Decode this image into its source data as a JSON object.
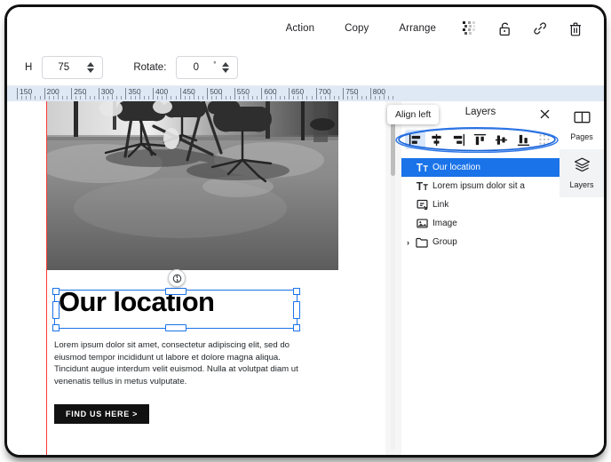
{
  "toolbar": {
    "actions": [
      {
        "label": "Action",
        "name": "action-button"
      },
      {
        "label": "Copy",
        "name": "copy-button"
      },
      {
        "label": "Arrange",
        "name": "arrange-button"
      }
    ],
    "icons": [
      {
        "name": "transparency-icon"
      },
      {
        "name": "unlock-icon"
      },
      {
        "name": "link-icon"
      },
      {
        "name": "trash-icon"
      }
    ]
  },
  "properties": {
    "height_label": "H",
    "height_value": "75",
    "rotate_label": "Rotate:",
    "rotate_value": "0",
    "degree_symbol": "°"
  },
  "ruler": {
    "ticks": [
      "150",
      "200",
      "250",
      "300",
      "350",
      "400",
      "450",
      "500",
      "550",
      "600",
      "650",
      "700",
      "750",
      "800"
    ]
  },
  "canvas": {
    "heading": "Our location",
    "paragraph": "Lorem ipsum dolor sit amet, consectetur adipiscing elit, sed do eiusmod tempor incididunt ut labore et dolore magna aliqua. Tincidunt augue interdum velit euismod. Nulla at volutpat diam ut venenatis tellus in metus vulputate.",
    "cta_label": "FIND US HERE >",
    "rotate_handle_name": "rotate-handle",
    "selection_color": "#1a73e8",
    "guide_color": "#ff3b30"
  },
  "panel": {
    "title": "Layers",
    "close_label": "✕",
    "tooltip": "Align left",
    "align_buttons": [
      {
        "name": "align-left-icon",
        "active": true
      },
      {
        "name": "align-center-horizontal-icon",
        "active": false
      },
      {
        "name": "align-right-icon",
        "active": false
      },
      {
        "name": "align-top-icon",
        "active": false
      },
      {
        "name": "align-middle-vertical-icon",
        "active": false
      },
      {
        "name": "align-bottom-icon",
        "active": false
      },
      {
        "name": "distribute-grid-icon",
        "active": false
      }
    ],
    "layers": [
      {
        "label": "Our location",
        "icon": "text-icon",
        "selected": true,
        "expandable": false
      },
      {
        "label": "Lorem ipsum dolor sit a",
        "icon": "text-icon",
        "selected": false,
        "expandable": false
      },
      {
        "label": "Link",
        "icon": "link-layer-icon",
        "selected": false,
        "expandable": false
      },
      {
        "label": "Image",
        "icon": "image-layer-icon",
        "selected": false,
        "expandable": false
      },
      {
        "label": "Group",
        "icon": "folder-icon",
        "selected": false,
        "expandable": true,
        "caret": "›"
      }
    ]
  },
  "rail": {
    "tabs": [
      {
        "label": "Pages",
        "name": "tab-pages",
        "icon": "book-icon",
        "active": false
      },
      {
        "label": "Layers",
        "name": "tab-layers",
        "icon": "layers-icon",
        "active": true
      }
    ]
  }
}
